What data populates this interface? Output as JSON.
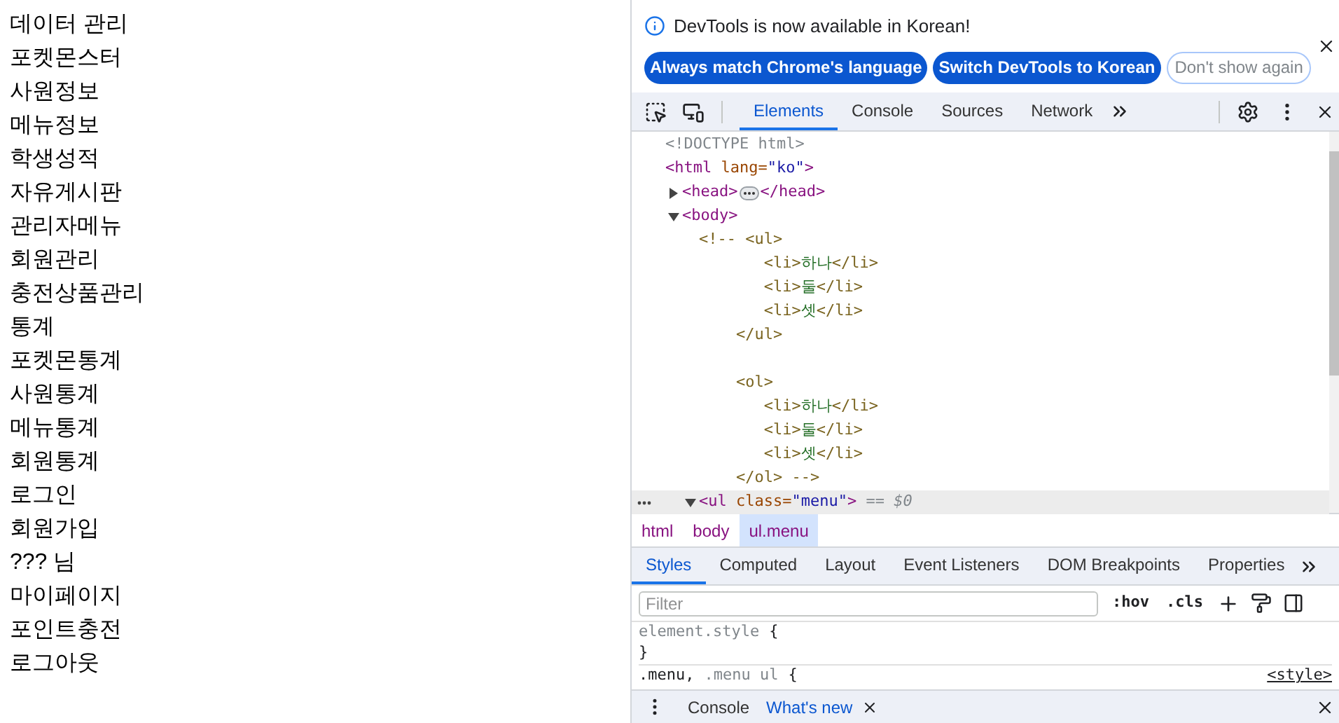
{
  "page": {
    "menu_items": [
      "데이터 관리",
      "포켓몬스터",
      "사원정보",
      "메뉴정보",
      "학생성적",
      "자유게시판",
      "관리자메뉴",
      "회원관리",
      "충전상품관리",
      "통계",
      "포켓몬통계",
      "사원통계",
      "메뉴통계",
      "회원통계",
      "로그인",
      "회원가입",
      "??? 님",
      "마이페이지",
      "포인트충전",
      "로그아웃"
    ]
  },
  "devtools": {
    "banner": {
      "message": "DevTools is now available in Korean!",
      "buttons": [
        {
          "label": "Always match Chrome's language",
          "kind": "primary"
        },
        {
          "label": "Switch DevTools to Korean",
          "kind": "primary"
        },
        {
          "label": "Don't show again",
          "kind": "outline"
        }
      ]
    },
    "panel_tabs": [
      {
        "label": "Elements",
        "selected": true
      },
      {
        "label": "Console",
        "selected": false
      },
      {
        "label": "Sources",
        "selected": false
      },
      {
        "label": "Network",
        "selected": false
      }
    ],
    "dom_tree": [
      {
        "selected": false,
        "tokens": [
          {
            "kind": "doctype",
            "text": "<!DOCTYPE html>"
          }
        ]
      },
      {
        "selected": false,
        "tokens": [
          {
            "kind": "tag",
            "text": "<html"
          },
          {
            "kind": "attr",
            "text": " lang="
          },
          {
            "kind": "value",
            "text": "\"ko\""
          },
          {
            "kind": "tag",
            "text": ">"
          }
        ],
        "children": [
          {
            "selected": false,
            "expanded": false,
            "tokens": [
              {
                "kind": "tag",
                "text": "<head>"
              },
              {
                "kind": "badge"
              },
              {
                "kind": "tag",
                "text": "</head>"
              }
            ]
          },
          {
            "selected": false,
            "expanded": true,
            "tokens": [
              {
                "kind": "tag",
                "text": "<body>"
              }
            ],
            "children": [
              {
                "lines": [
                  {
                    "kind": "code",
                    "tokens": [
                      {
                        "kind": "comment",
                        "text": "<!-- <ul>"
                      }
                    ]
                  },
                  {
                    "kind": "code",
                    "tokens": [
                      {
                        "kind": "comment",
                        "text": "       <li>"
                      },
                      {
                        "kind": "text",
                        "text": "하나"
                      },
                      {
                        "kind": "comment",
                        "text": "</li>"
                      }
                    ]
                  },
                  {
                    "kind": "code",
                    "tokens": [
                      {
                        "kind": "comment",
                        "text": "       <li>"
                      },
                      {
                        "kind": "text",
                        "text": "둘"
                      },
                      {
                        "kind": "comment",
                        "text": "</li>"
                      }
                    ]
                  },
                  {
                    "kind": "code",
                    "tokens": [
                      {
                        "kind": "comment",
                        "text": "       <li>"
                      },
                      {
                        "kind": "text",
                        "text": "셋"
                      },
                      {
                        "kind": "comment",
                        "text": "</li>"
                      }
                    ]
                  },
                  {
                    "kind": "code",
                    "tokens": [
                      {
                        "kind": "comment",
                        "text": "    </ul>"
                      }
                    ]
                  },
                  {
                    "kind": "blank"
                  },
                  {
                    "kind": "code",
                    "tokens": [
                      {
                        "kind": "comment",
                        "text": "    <ol>"
                      }
                    ]
                  },
                  {
                    "kind": "code",
                    "tokens": [
                      {
                        "kind": "comment",
                        "text": "       <li>"
                      },
                      {
                        "kind": "text",
                        "text": "하나"
                      },
                      {
                        "kind": "comment",
                        "text": "</li>"
                      }
                    ]
                  },
                  {
                    "kind": "code",
                    "tokens": [
                      {
                        "kind": "comment",
                        "text": "       <li>"
                      },
                      {
                        "kind": "text",
                        "text": "둘"
                      },
                      {
                        "kind": "comment",
                        "text": "</li>"
                      }
                    ]
                  },
                  {
                    "kind": "code",
                    "tokens": [
                      {
                        "kind": "comment",
                        "text": "       <li>"
                      },
                      {
                        "kind": "text",
                        "text": "셋"
                      },
                      {
                        "kind": "comment",
                        "text": "</li>"
                      }
                    ]
                  },
                  {
                    "kind": "code",
                    "tokens": [
                      {
                        "kind": "comment",
                        "text": "    </ol> -->"
                      }
                    ]
                  }
                ]
              },
              {
                "selected": true,
                "expanded": true,
                "tokens": [
                  {
                    "kind": "tag",
                    "text": "<ul"
                  },
                  {
                    "kind": "attr",
                    "text": " class="
                  },
                  {
                    "kind": "value",
                    "text": "\"menu\""
                  },
                  {
                    "kind": "tag",
                    "text": ">"
                  },
                  {
                    "kind": "ref",
                    "text": " == $0"
                  }
                ]
              }
            ]
          }
        ]
      }
    ],
    "breadcrumbs": [
      {
        "label": "html",
        "selected": false
      },
      {
        "label": "body",
        "selected": false
      },
      {
        "label": "ul.menu",
        "selected": true
      }
    ],
    "sidebar_tabs": [
      {
        "label": "Styles",
        "selected": true
      },
      {
        "label": "Computed",
        "selected": false
      },
      {
        "label": "Layout",
        "selected": false
      },
      {
        "label": "Event Listeners",
        "selected": false
      },
      {
        "label": "DOM Breakpoints",
        "selected": false
      },
      {
        "label": "Properties",
        "selected": false
      }
    ],
    "styles": {
      "filter": {
        "placeholder": "Filter"
      },
      "toggles": [
        ":hov",
        ".cls"
      ],
      "rules": [
        {
          "selectors": [
            {
              "text": "element.style",
              "matched": false
            }
          ],
          "open": "{",
          "close": "}"
        },
        {
          "selectors": [
            {
              "text": ".menu,",
              "matched": true
            },
            {
              "text": ".menu ul",
              "matched": false
            }
          ],
          "open": "{",
          "source": "<style>"
        }
      ]
    },
    "drawer": {
      "tabs": [
        {
          "label": "Console",
          "selected": false,
          "closable": false
        },
        {
          "label": "What's new",
          "selected": true,
          "closable": true
        }
      ]
    }
  }
}
